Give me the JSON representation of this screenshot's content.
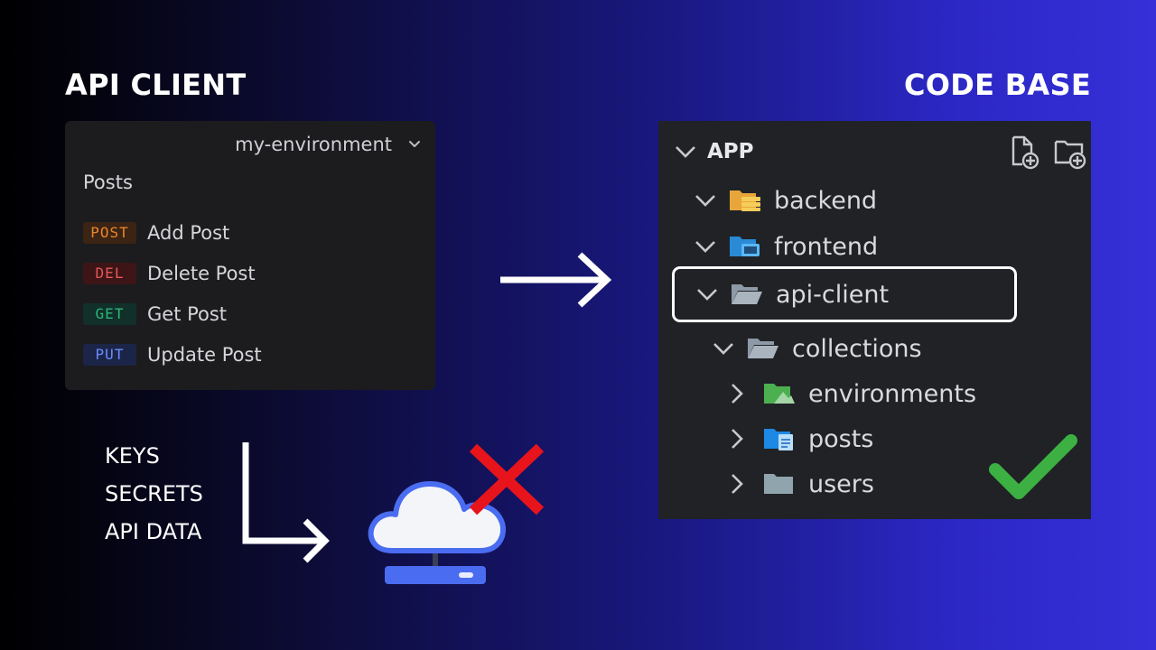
{
  "headings": {
    "left": "API CLIENT",
    "right": "CODE BASE"
  },
  "api_client": {
    "environment": "my-environment",
    "collection_title": "Posts",
    "requests": [
      {
        "method": "POST",
        "name": "Add Post",
        "color": "#e8862c",
        "bg": "#3b2414"
      },
      {
        "method": "DEL",
        "name": "Delete Post",
        "color": "#e25858",
        "bg": "#3d1516"
      },
      {
        "method": "GET",
        "name": "Get Post",
        "color": "#2fb57a",
        "bg": "#11302a"
      },
      {
        "method": "PUT",
        "name": "Update Post",
        "color": "#6a8cff",
        "bg": "#1b2547"
      }
    ]
  },
  "keys_list": [
    "KEYS",
    "SECRETS",
    "API DATA"
  ],
  "code_base": {
    "root": "APP",
    "items": [
      {
        "label": "backend",
        "icon": "folder-server-icon",
        "expanded": true
      },
      {
        "label": "frontend",
        "icon": "folder-frontend-icon",
        "expanded": true
      },
      {
        "label": "api-client",
        "icon": "folder-open-icon",
        "expanded": true,
        "highlighted": true
      },
      {
        "label": "collections",
        "icon": "folder-open-icon",
        "expanded": true
      },
      {
        "label": "environments",
        "icon": "folder-environment-icon",
        "expanded": false
      },
      {
        "label": "posts",
        "icon": "folder-docs-icon",
        "expanded": false
      },
      {
        "label": "users",
        "icon": "folder-icon",
        "expanded": false
      }
    ]
  },
  "colors": {
    "check": "#3cb043",
    "cross": "#e8141b",
    "cloud_outline": "#4a6cf0"
  }
}
